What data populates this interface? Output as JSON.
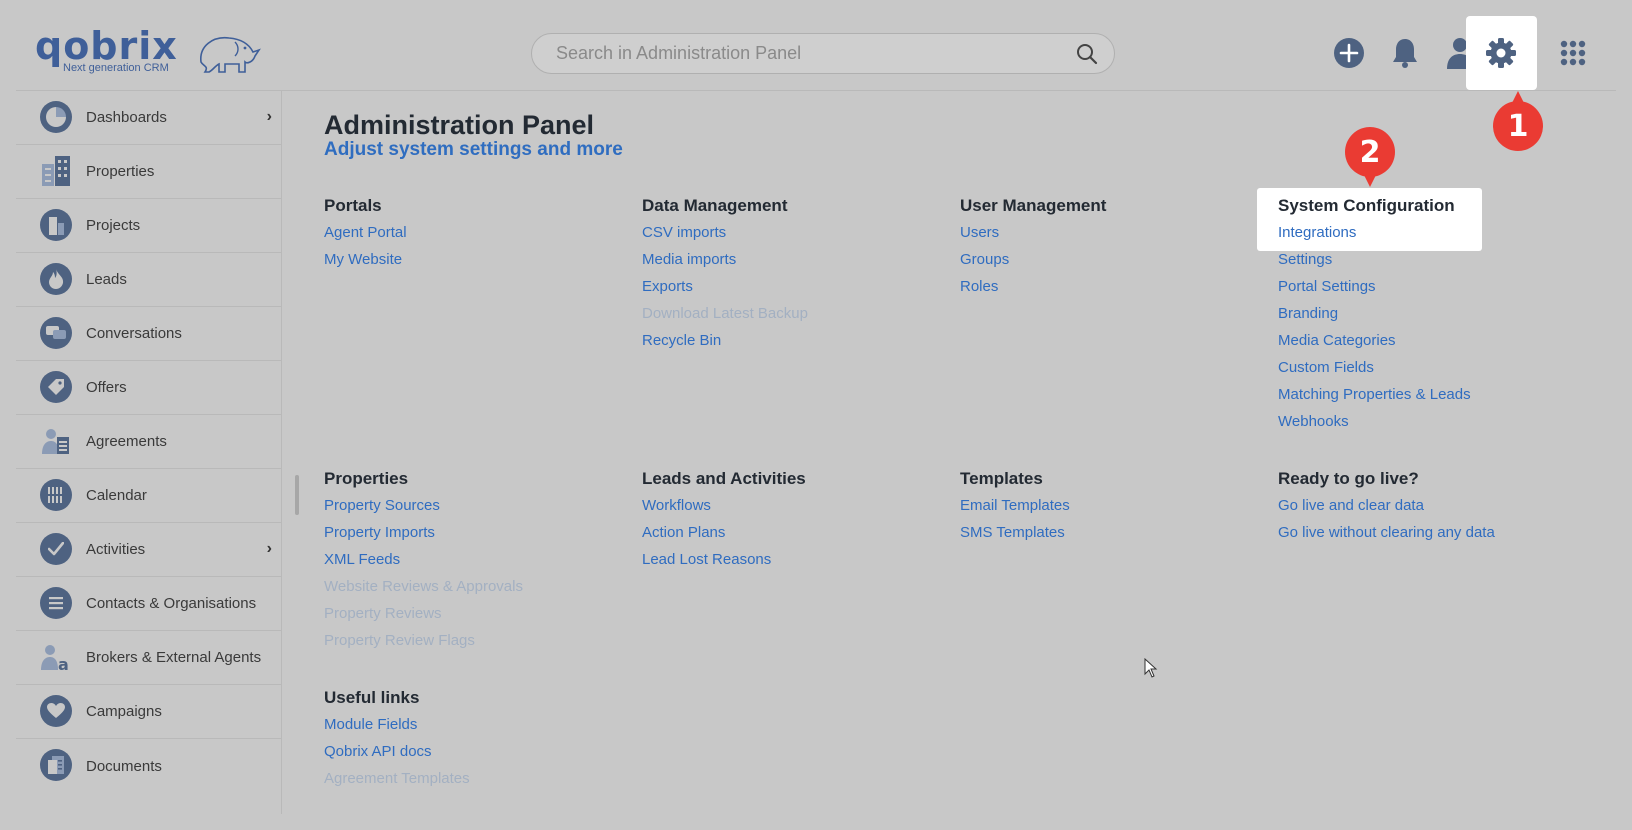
{
  "header": {
    "logo_text": "qobrix",
    "logo_tagline": "Next generation CRM",
    "search_placeholder": "Search in Administration Panel",
    "badge_1": "1",
    "badge_2": "2"
  },
  "sidebar": {
    "items": [
      {
        "label": "Dashboards",
        "icon": "pie-chart-icon",
        "chevron": "›"
      },
      {
        "label": "Properties",
        "icon": "buildings-icon"
      },
      {
        "label": "Projects",
        "icon": "project-building-icon"
      },
      {
        "label": "Leads",
        "icon": "flame-icon"
      },
      {
        "label": "Conversations",
        "icon": "chat-icon"
      },
      {
        "label": "Offers",
        "icon": "tag-icon"
      },
      {
        "label": "Agreements",
        "icon": "agreement-icon"
      },
      {
        "label": "Calendar",
        "icon": "calendar-icon"
      },
      {
        "label": "Activities",
        "icon": "checkmark-icon",
        "chevron": "›"
      },
      {
        "label": "Contacts & Organisations",
        "icon": "list-icon"
      },
      {
        "label": "Brokers & External Agents",
        "icon": "broker-icon"
      },
      {
        "label": "Campaigns",
        "icon": "heart-icon"
      },
      {
        "label": "Documents",
        "icon": "document-icon"
      }
    ]
  },
  "main": {
    "title": "Administration Panel",
    "subtitle": "Adjust system settings and more",
    "sections": [
      {
        "heading": "Portals",
        "links": [
          {
            "label": "Agent Portal"
          },
          {
            "label": "My Website"
          }
        ]
      },
      {
        "heading": "Data Management",
        "links": [
          {
            "label": "CSV imports"
          },
          {
            "label": "Media imports"
          },
          {
            "label": "Exports"
          },
          {
            "label": "Download Latest Backup",
            "disabled": true
          },
          {
            "label": "Recycle Bin"
          }
        ]
      },
      {
        "heading": "User Management",
        "links": [
          {
            "label": "Users"
          },
          {
            "label": "Groups"
          },
          {
            "label": "Roles"
          }
        ]
      },
      {
        "heading": "System Configuration",
        "links": [
          {
            "label": "Integrations"
          },
          {
            "label": "Settings"
          },
          {
            "label": "Portal Settings"
          },
          {
            "label": "Branding"
          },
          {
            "label": "Media Categories"
          },
          {
            "label": "Custom Fields"
          },
          {
            "label": "Matching Properties & Leads"
          },
          {
            "label": "Webhooks"
          }
        ]
      },
      {
        "heading": "Properties",
        "links": [
          {
            "label": "Property Sources"
          },
          {
            "label": "Property Imports"
          },
          {
            "label": "XML Feeds"
          },
          {
            "label": "Website Reviews & Approvals",
            "disabled": true
          },
          {
            "label": "Property Reviews",
            "disabled": true
          },
          {
            "label": "Property Review Flags",
            "disabled": true
          }
        ]
      },
      {
        "heading": "Leads and Activities",
        "links": [
          {
            "label": "Workflows"
          },
          {
            "label": "Action Plans"
          },
          {
            "label": "Lead Lost Reasons"
          }
        ]
      },
      {
        "heading": "Templates",
        "links": [
          {
            "label": "Email Templates"
          },
          {
            "label": "SMS Templates"
          }
        ]
      },
      {
        "heading": "Ready to go live?",
        "links": [
          {
            "label": "Go live and clear data"
          },
          {
            "label": "Go live without clearing any data"
          }
        ]
      },
      {
        "heading": "Useful links",
        "links": [
          {
            "label": "Module Fields"
          },
          {
            "label": "Qobrix API docs"
          },
          {
            "label": "Agreement Templates",
            "disabled": true
          }
        ]
      }
    ]
  },
  "colors": {
    "background": "#c8c8c8",
    "link": "#2f6cc0",
    "link_disabled": "#a3b0c2",
    "icon": "#4e6281",
    "badge": "#ea3b33"
  }
}
